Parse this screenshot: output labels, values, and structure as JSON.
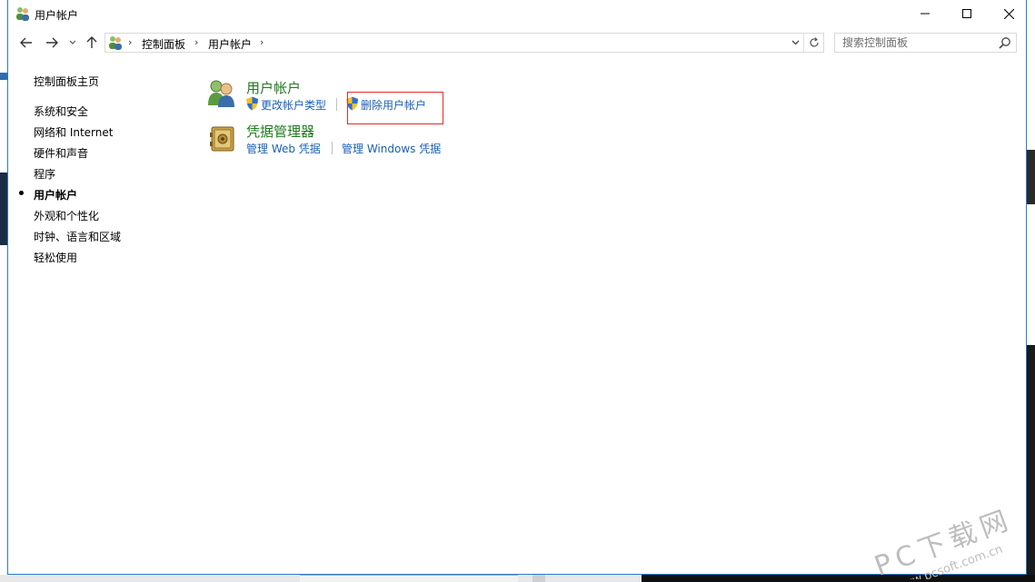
{
  "window": {
    "title": "用户帐户",
    "controls": {
      "minimize": "minimize",
      "maximize": "maximize",
      "close": "close"
    }
  },
  "address": {
    "breadcrumbs": [
      "控制面板",
      "用户帐户"
    ],
    "search_placeholder": "搜索控制面板"
  },
  "sidebar": {
    "home": "控制面板主页",
    "items": [
      {
        "label": "系统和安全",
        "active": false
      },
      {
        "label": "网络和 Internet",
        "active": false
      },
      {
        "label": "硬件和声音",
        "active": false
      },
      {
        "label": "程序",
        "active": false
      },
      {
        "label": "用户帐户",
        "active": true
      },
      {
        "label": "外观和个性化",
        "active": false
      },
      {
        "label": "时钟、语言和区域",
        "active": false
      },
      {
        "label": "轻松使用",
        "active": false
      }
    ]
  },
  "categories": [
    {
      "title": "用户帐户",
      "icon": "users-icon",
      "links": [
        "更改帐户类型",
        "删除用户帐户"
      ]
    },
    {
      "title": "凭据管理器",
      "icon": "vault-icon",
      "links": [
        "管理 Web 凭据",
        "管理 Windows 凭据"
      ]
    }
  ],
  "watermark": {
    "line1": "PC下载网",
    "line2": "www.pcsoft.com.cn"
  },
  "colors": {
    "title_green": "#1e7a1e",
    "link_blue": "#1a5fb4",
    "highlight_red": "#e22b2b",
    "window_border": "#2b7ad0"
  }
}
